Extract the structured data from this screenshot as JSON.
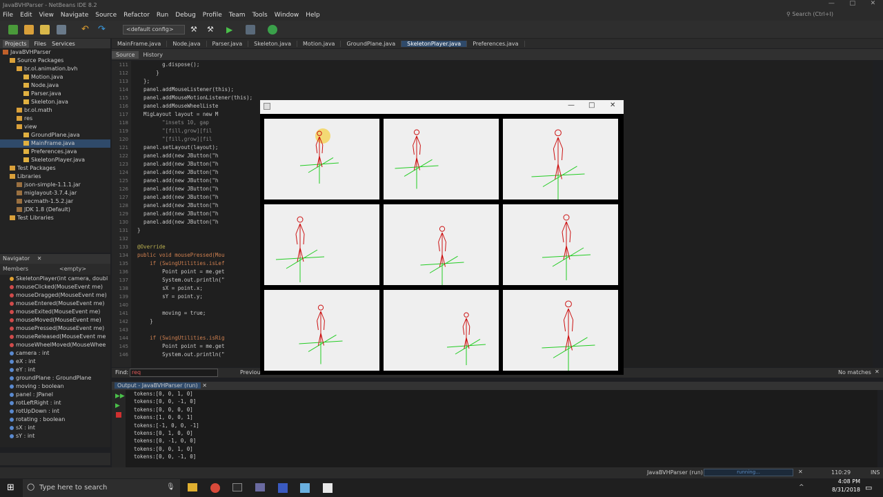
{
  "titlebar": {
    "title": "JavaBVHParser - NetBeans IDE 8.2"
  },
  "menu": [
    "File",
    "Edit",
    "View",
    "Navigate",
    "Source",
    "Refactor",
    "Run",
    "Debug",
    "Profile",
    "Team",
    "Tools",
    "Window",
    "Help"
  ],
  "search_placeholder": "Search (Ctrl+I)",
  "toolbar": {
    "config": "<default config>"
  },
  "left_tabs": [
    "Projects",
    "Files",
    "Services"
  ],
  "project_tree": [
    {
      "label": "JavaBVHParser",
      "indent": 0,
      "kind": "project"
    },
    {
      "label": "Source Packages",
      "indent": 1,
      "kind": "folder"
    },
    {
      "label": "br.ol.animation.bvh",
      "indent": 2,
      "kind": "pkg"
    },
    {
      "label": "Motion.java",
      "indent": 3,
      "kind": "java"
    },
    {
      "label": "Node.java",
      "indent": 3,
      "kind": "java"
    },
    {
      "label": "Parser.java",
      "indent": 3,
      "kind": "java"
    },
    {
      "label": "Skeleton.java",
      "indent": 3,
      "kind": "java"
    },
    {
      "label": "br.ol.math",
      "indent": 2,
      "kind": "pkg"
    },
    {
      "label": "res",
      "indent": 2,
      "kind": "pkg"
    },
    {
      "label": "view",
      "indent": 2,
      "kind": "pkg"
    },
    {
      "label": "GroundPlane.java",
      "indent": 3,
      "kind": "java"
    },
    {
      "label": "MainFrame.java",
      "indent": 3,
      "kind": "java",
      "selected": true
    },
    {
      "label": "Preferences.java",
      "indent": 3,
      "kind": "java"
    },
    {
      "label": "SkeletonPlayer.java",
      "indent": 3,
      "kind": "java"
    },
    {
      "label": "Test Packages",
      "indent": 1,
      "kind": "folder"
    },
    {
      "label": "Libraries",
      "indent": 1,
      "kind": "folder"
    },
    {
      "label": "json-simple-1.1.1.jar",
      "indent": 2,
      "kind": "jar"
    },
    {
      "label": "miglayout-3.7.4.jar",
      "indent": 2,
      "kind": "jar"
    },
    {
      "label": "vecmath-1.5.2.jar",
      "indent": 2,
      "kind": "jar"
    },
    {
      "label": "JDK 1.8 (Default)",
      "indent": 2,
      "kind": "jar"
    },
    {
      "label": "Test Libraries",
      "indent": 1,
      "kind": "folder"
    }
  ],
  "navigator": {
    "title": "Navigator",
    "members": "Members",
    "empty": "<empty>"
  },
  "navigator_items": [
    "SkeletonPlayer(int camera, doubl",
    "mouseClicked(MouseEvent me)",
    "mouseDragged(MouseEvent me)",
    "mouseEntered(MouseEvent me)",
    "mouseExited(MouseEvent me)",
    "mouseMoved(MouseEvent me)",
    "mousePressed(MouseEvent me)",
    "mouseReleased(MouseEvent me",
    "mouseWheelMoved(MouseWhee",
    "camera : int",
    "eX : int",
    "eY : int",
    "groundPlane : GroundPlane",
    "moving : boolean",
    "panel : JPanel",
    "rotLeftRight : int",
    "rotUpDown : int",
    "rotating : boolean",
    "sX : int",
    "sY : int"
  ],
  "editor_tabs": [
    "MainFrame.java",
    "Node.java",
    "Parser.java",
    "Skeleton.java",
    "Motion.java",
    "GroundPlane.java",
    "SkeletonPlayer.java",
    "Preferences.java"
  ],
  "active_tab": "SkeletonPlayer.java",
  "source_tabs": [
    "Source",
    "History"
  ],
  "line_numbers": [
    "111",
    "112",
    "113",
    "114",
    "115",
    "116",
    "117",
    "118",
    "119",
    "120",
    "121",
    "122",
    "123",
    "124",
    "125",
    "126",
    "127",
    "128",
    "129",
    "130",
    "131",
    "132",
    "133",
    "134",
    "135",
    "136",
    "137",
    "138",
    "139",
    "140",
    "141",
    "142",
    "143",
    "144",
    "145",
    "146"
  ],
  "code_lines": [
    "          g.dispose();",
    "        }",
    "    };",
    "    panel.addMouseListener(this);",
    "    panel.addMouseMotionListener(this);",
    "    panel.addMouseWheelListe",
    "    MigLayout layout = new M",
    "          \"insets 10, gap",
    "          \"[fill,grow][fil",
    "          \"[fill,grow][fil",
    "    panel.setLayout(layout);",
    "    panel.add(new JButton(\"h",
    "    panel.add(new JButton(\"h",
    "    panel.add(new JButton(\"h",
    "    panel.add(new JButton(\"h",
    "    panel.add(new JButton(\"h",
    "    panel.add(new JButton(\"h",
    "    panel.add(new JButton(\"h",
    "    panel.add(new JButton(\"h",
    "    panel.add(new JButton(\"h",
    "  }",
    "",
    "  @Override",
    "  public void mousePressed(Mou",
    "      if (SwingUtilities.isLef",
    "          Point point = me.get",
    "          System.out.println(\"",
    "          sX = point.x;",
    "          sY = point.y;",
    "",
    "          moving = true;",
    "      }",
    "",
    "      if (SwingUtilities.isRig",
    "          Point point = me.get",
    "          System.out.println(\""
  ],
  "find": {
    "label": "Find:",
    "value": "req",
    "previous": "Previous",
    "no_matches": "No matches"
  },
  "output": {
    "title": "Output - JavaBVHParser (run)",
    "lines": [
      "tokens:[0, 0, 1, 0]",
      "tokens:[0, 0, -1, 0]",
      "tokens:[0, 0, 0, 0]",
      "tokens:[1, 0, 0, 1]",
      "tokens:[-1, 0, 0, -1]",
      "tokens:[0, 1, 0, 0]",
      "tokens:[0, -1, 0, 0]",
      "tokens:[0, 0, 1, 0]",
      "tokens:[0, 0, -1, 0]"
    ]
  },
  "status": {
    "project": "JavaBVHParser (run)",
    "running": "running...",
    "position": "110:29",
    "mode": "INS"
  },
  "taskbar": {
    "search": "Type here to search",
    "time": "4:08 PM",
    "date": "8/31/2018"
  },
  "player": {
    "minimize": "—",
    "maximize": "□",
    "close": "✕"
  },
  "colors": {
    "accent": "#2f4a6a",
    "skeleton": "#cc1111",
    "ground": "#22cc22",
    "pane_bg": "#efefef"
  }
}
